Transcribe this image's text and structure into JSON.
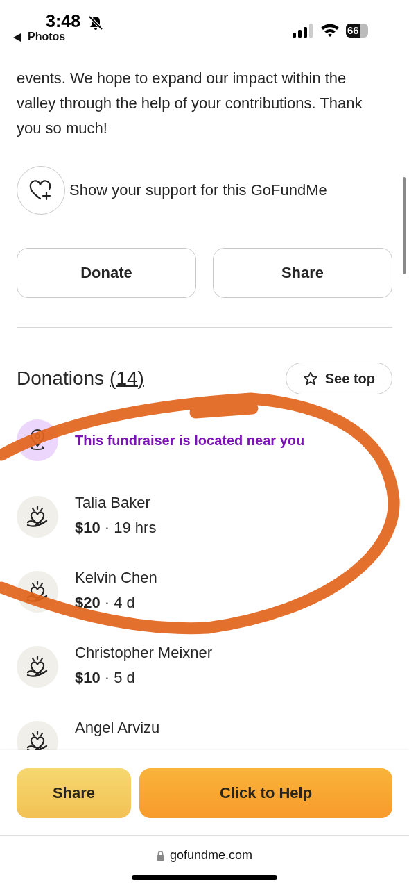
{
  "status_bar": {
    "time": "3:48",
    "back_label": "Photos",
    "battery": "66",
    "silenced": true
  },
  "description": {
    "text": "events. We hope to expand our impact within the valley through the help of your contributions. Thank you so much!"
  },
  "support": {
    "label": "Show your support for this GoFundMe"
  },
  "actions": [
    "Donate",
    "Share"
  ],
  "donations": {
    "title": "Donations",
    "count": "(14)",
    "see_top": "See top",
    "notice": "This fundraiser is located near you",
    "items": [
      {
        "name": "Talia Baker",
        "amount": "$10",
        "time": "· 19 hrs"
      },
      {
        "name": "Kelvin Chen",
        "amount": "$20",
        "time": "· 4 d"
      },
      {
        "name": "Christopher Meixner",
        "amount": "$10",
        "time": "· 5 d"
      },
      {
        "name": "Angel Arvizu"
      }
    ]
  },
  "bottom_bar": {
    "buttons": [
      {
        "label": "Share",
        "kind": "secondary"
      },
      {
        "label": "Click to Help",
        "kind": "primary"
      }
    ],
    "url": "gofundme.com"
  },
  "annotation": {
    "kind": "circle",
    "color": "#e2641c"
  }
}
